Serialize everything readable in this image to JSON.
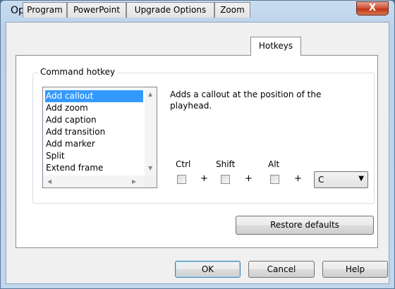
{
  "window": {
    "title": "Options",
    "close_glyph": "X"
  },
  "tabs": [
    {
      "label": "Program",
      "active": false
    },
    {
      "label": "PowerPoint",
      "active": false
    },
    {
      "label": "Upgrade Options",
      "active": false
    },
    {
      "label": "Zoom",
      "active": false
    },
    {
      "label": "Hotkeys",
      "active": true
    }
  ],
  "group": {
    "label": "Command hotkey",
    "commands": [
      "Add callout",
      "Add zoom",
      "Add caption",
      "Add transition",
      "Add marker",
      "Split",
      "Extend frame"
    ],
    "selected_command": "Add callout",
    "description": "Adds a callout at the position of the playhead.",
    "modifiers": {
      "ctrl": {
        "label": "Ctrl",
        "checked": false
      },
      "shift": {
        "label": "Shift",
        "checked": false
      },
      "alt": {
        "label": "Alt",
        "checked": false
      }
    },
    "plus": "+",
    "key": {
      "value": "C"
    }
  },
  "buttons": {
    "restore_defaults": "Restore defaults",
    "ok": "OK",
    "cancel": "Cancel",
    "help": "Help"
  }
}
